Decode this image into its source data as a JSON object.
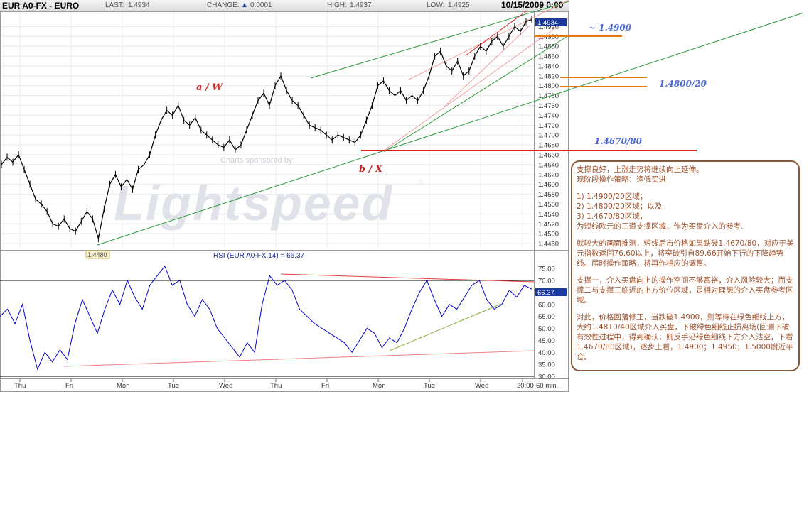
{
  "header": {
    "symbol": "EUR A0-FX - EURO",
    "last_label": "LAST:",
    "last": "1.4934",
    "change_label": "CHANGE:",
    "change_icon": "triangle-up-icon",
    "change": "0.0001",
    "high_label": "HIGH:",
    "high": "1.4937",
    "low_label": "LOW:",
    "low": "1.4925",
    "date": "10/15/2009 0:00"
  },
  "colors": {
    "price": "#000000",
    "rsi": "#0000cc",
    "support": "#e0201a",
    "target": "#e07a10",
    "channel_green": "#2a9a3a",
    "channel_pink": "#f08080",
    "annotation_blue": "#4a6ad8",
    "annotation_red": "#cc2222",
    "note_text": "#a0522d"
  },
  "watermark": {
    "sponsor": "Charts sponsored by:",
    "brand": "Lightspeed",
    "mark": "®"
  },
  "annotations": {
    "wave_a": "a / W",
    "wave_b": "b / X",
    "level_1": "~ 1.4900",
    "level_2": "1.4800/20",
    "level_3": "1.4670/80"
  },
  "price_scale": {
    "current": "1.4934",
    "bottom_tag": "1.4480"
  },
  "rsi_scale": {
    "title": "RSI (EUR A0-FX,14) = 66.37",
    "current": "66.37"
  },
  "note": {
    "p1_l1": "支撑良好，上涨走势将继续向上延伸。",
    "p1_l2": "现阶段操作策略：逢低买进",
    "p2_l1": "1) 1.4900/20区域；",
    "p2_l2": "2) 1.4800/20区域；以及",
    "p2_l3": "3) 1.4670/80区域，",
    "p2_l4": "为短线欧元的三道支撑区域，作为买盘介入的参考.",
    "p3": "就较大的画面推测，短线后市价格如果跌破1.4670/80，对应于美元指数返回76.60以上，将突破引自89.66开始下行的下降趋势线。届时操作策略，将再作相应的调整。",
    "p4": "支撑一，介入买盘向上的操作空间不够富裕，介入风险较大；而支撑二与支撑三临近的上方价位区域，是相对理想的介入买盘参考区域。",
    "p5": "对此，价格回落修正，当跌破1.4900，则等待在绿色细线上方，大约1.4810/40区域介入买盘，下破绿色细线止损离场(回测下破有效性过程中，得到确认，则反手沿绿色细线下方介入沽空，下看1.4670/80区域)，逐步上看，1.4900；1.4950；1.5000附近平仓。"
  },
  "chart_data": [
    {
      "type": "line",
      "title": "EUR A0-FX - EURO",
      "interval": "60 min.",
      "ylim": [
        1.447,
        1.4945
      ],
      "y_ticks": [
        "1.4480",
        "1.4500",
        "1.4520",
        "1.4540",
        "1.4560",
        "1.4580",
        "1.4600",
        "1.4620",
        "1.4640",
        "1.4660",
        "1.4680",
        "1.4700",
        "1.4720",
        "1.4740",
        "1.4760",
        "1.4780",
        "1.4800",
        "1.4820",
        "1.4840",
        "1.4860",
        "1.4880",
        "1.4900",
        "1.4920"
      ],
      "x_ticks": [
        "Thu",
        "Fri",
        "Mon",
        "Tue",
        "Wed",
        "Thu",
        "Fri",
        "Mon",
        "Tue",
        "Wed",
        "20:00"
      ],
      "grid": true,
      "series": [
        {
          "values": [
            1.464,
            1.4655,
            1.4645,
            1.466,
            1.463,
            1.46,
            1.457,
            1.456,
            1.4545,
            1.452,
            1.4515,
            1.453,
            1.451,
            1.4505,
            1.4525,
            1.4545,
            1.453,
            1.449,
            1.455,
            1.46,
            1.462,
            1.4595,
            1.461,
            1.459,
            1.463,
            1.464,
            1.466,
            1.47,
            1.473,
            1.475,
            1.474,
            1.476,
            1.473,
            1.472,
            1.4735,
            1.471,
            1.47,
            1.469,
            1.468,
            1.4675,
            1.469,
            1.467,
            1.468,
            1.471,
            1.474,
            1.477,
            1.4785,
            1.476,
            1.48,
            1.482,
            1.479,
            1.477,
            1.476,
            1.474,
            1.472,
            1.4715,
            1.471,
            1.47,
            1.469,
            1.47,
            1.4695,
            1.469,
            1.4685,
            1.47,
            1.473,
            1.476,
            1.48,
            1.481,
            1.479,
            1.478,
            1.479,
            1.477,
            1.478,
            1.477,
            1.479,
            1.482,
            1.486,
            1.487,
            1.484,
            1.483,
            1.485,
            1.482,
            1.483,
            1.486,
            1.488,
            1.487,
            1.489,
            1.49,
            1.488,
            1.49,
            1.492,
            1.491,
            1.493,
            1.4934
          ]
        }
      ],
      "support_levels": [
        {
          "label": "~ 1.4900",
          "value": 1.49
        },
        {
          "label": "1.4800/20",
          "range": [
            1.48,
            1.482
          ]
        },
        {
          "label": "1.4670/80",
          "value": 1.467
        }
      ]
    },
    {
      "type": "line",
      "title": "RSI (EUR A0-FX,14) = 66.37",
      "ylim": [
        30,
        78
      ],
      "y_ticks": [
        "30.00",
        "35.00",
        "40.00",
        "45.00",
        "50.00",
        "55.00",
        "60.00",
        "65.00",
        "70.00",
        "75.00"
      ],
      "reference_lines": [
        70,
        30
      ],
      "series": [
        {
          "values": [
            55,
            58,
            52,
            60,
            45,
            33,
            40,
            36,
            41,
            37,
            52,
            62,
            55,
            48,
            58,
            66,
            60,
            70,
            63,
            58,
            68,
            72,
            76,
            68,
            70,
            60,
            55,
            62,
            58,
            50,
            46,
            42,
            38,
            44,
            40,
            60,
            72,
            68,
            70,
            66,
            58,
            55,
            52,
            50,
            48,
            46,
            44,
            40,
            45,
            50,
            48,
            42,
            46,
            44,
            50,
            58,
            65,
            70,
            62,
            55,
            60,
            58,
            63,
            68,
            70,
            62,
            58,
            60,
            66,
            63,
            68,
            66.37
          ]
        }
      ]
    }
  ]
}
